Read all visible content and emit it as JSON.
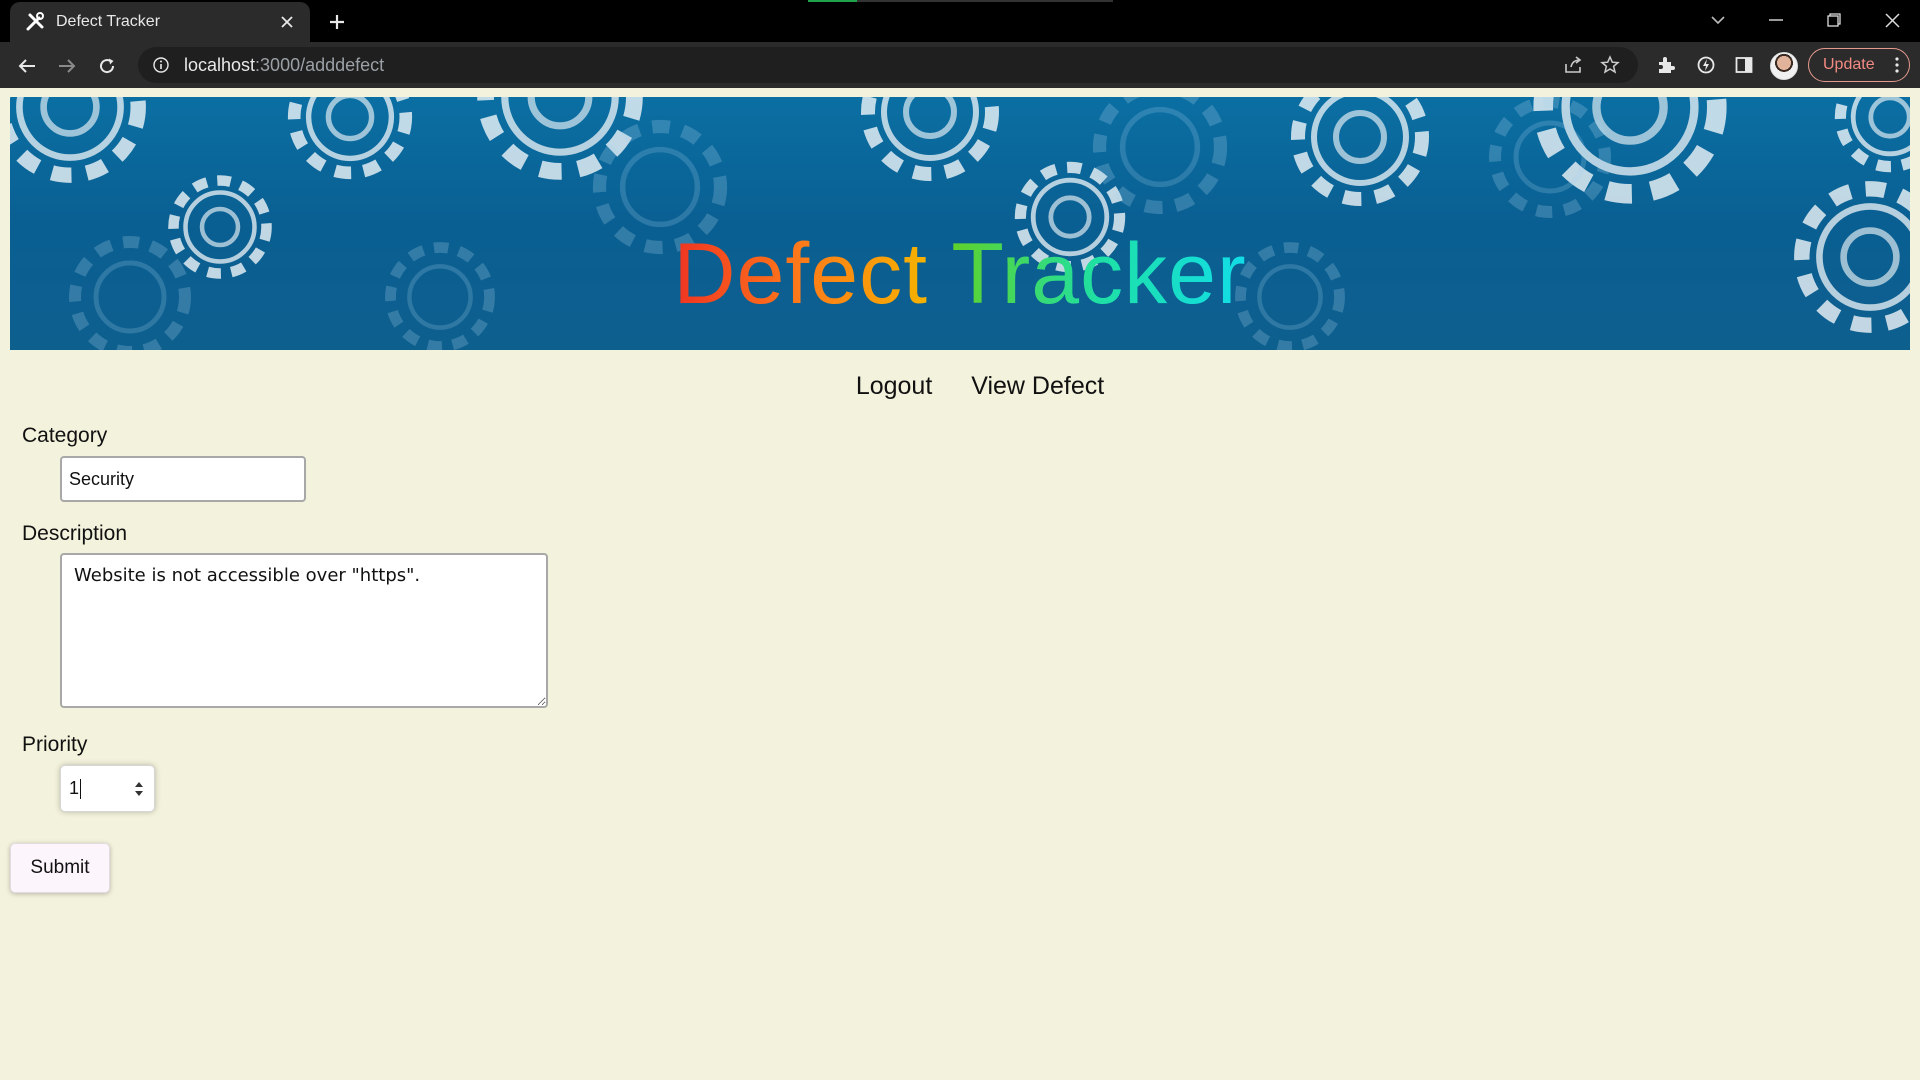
{
  "browser": {
    "tab_title": "Defect Tracker",
    "url_host": "localhost",
    "url_rest": ":3000/adddefect",
    "update_label": "Update",
    "load_progress": 0.16
  },
  "banner": {
    "title_word1": "Defect",
    "title_word2": "Tracker"
  },
  "nav": {
    "logout": "Logout",
    "view_defect": "View Defect"
  },
  "form": {
    "category_label": "Category",
    "category_value": "Security",
    "description_label": "Description",
    "description_value": "Website is not accessible over \"https\".",
    "priority_label": "Priority",
    "priority_value": "1",
    "submit_label": "Submit"
  },
  "colors": {
    "page_background": "#f3f2dc",
    "banner_blue": "#0a5f92",
    "title_gradient": [
      "#ee3322",
      "#ff7a1a",
      "#f5b300",
      "#5fd12a",
      "#1ee0a5",
      "#12dde8"
    ]
  }
}
